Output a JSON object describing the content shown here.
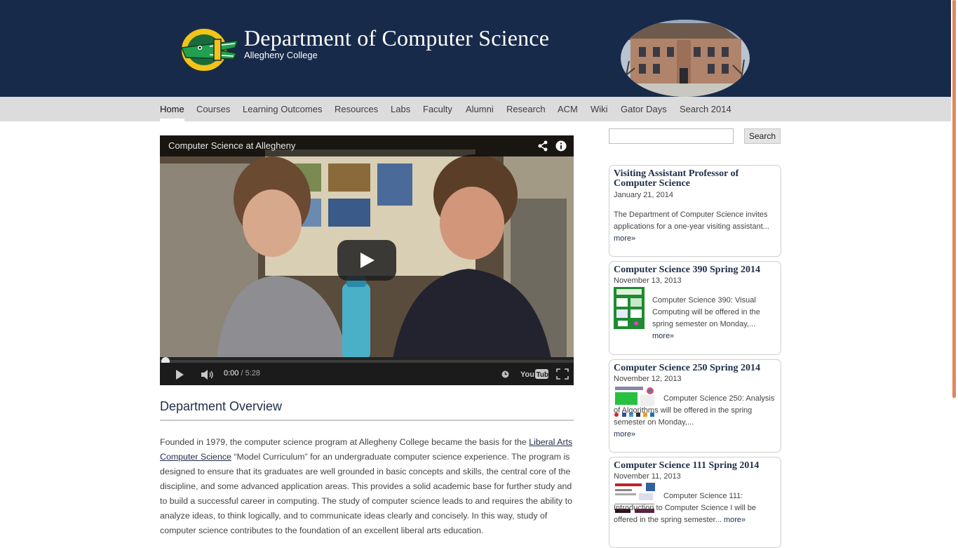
{
  "header": {
    "title": "Department of Computer Science",
    "subtitle": "Allegheny College",
    "logo_text_top": "ALLEGHENY",
    "logo_text_bottom": "GATORS"
  },
  "nav": {
    "items": [
      {
        "label": "Home",
        "active": true
      },
      {
        "label": "Courses"
      },
      {
        "label": "Learning Outcomes"
      },
      {
        "label": "Resources"
      },
      {
        "label": "Labs"
      },
      {
        "label": "Faculty"
      },
      {
        "label": "Alumni"
      },
      {
        "label": "Research"
      },
      {
        "label": "ACM"
      },
      {
        "label": "Wiki"
      },
      {
        "label": "Gator Days"
      },
      {
        "label": "Search 2014"
      }
    ]
  },
  "video": {
    "title": "Computer Science at Allegheny",
    "current_time": "0:00",
    "duration": " / 5:28",
    "progress": 0,
    "youtube_label": "YouTube"
  },
  "overview": {
    "heading": "Department Overview",
    "text_before_link": "Founded in 1979, the computer science program at Allegheny College became the basis for the ",
    "link_text": "Liberal Arts Computer Science",
    "text_after_link": " “Model Curriculum” for an undergraduate computer science experience.  The program is designed to ensure that its graduates are well grounded in basic concepts and skills, the central core of the discipline, and some advanced application areas.  This provides a solid academic base for further study and to build a successful career in computing.  The study of computer science leads to and requires the ability to analyze ideas, to think logically, and to communicate ideas clearly and concisely.  In this way, study of computer science contributes to the foundation of an excellent liberal arts education."
  },
  "sidebar": {
    "search": {
      "value": "",
      "placeholder": "",
      "button_label": "Search"
    },
    "posts": [
      {
        "title": "Visiting Assistant Professor of Computer Science",
        "date": "January 21, 2014",
        "excerpt": "The Department of Computer Science invites applications for a one-year visiting assistant...",
        "more": "more»"
      },
      {
        "title": "Computer Science 390 Spring 2014",
        "date": "November 13, 2013",
        "excerpt": "Computer Science 390: Visual Computing will be offered in the spring semester on Monday,...",
        "more": "more»"
      },
      {
        "title": "Computer Science 250 Spring 2014",
        "date": "November 12, 2013",
        "excerpt": "Computer Science 250: Analysis of Algorithms will be offered in the spring semester on Monday,...",
        "more": "more»"
      },
      {
        "title": "Computer Science 111 Spring 2014",
        "date": "November 11, 2013",
        "excerpt": "Computer Science 111: Introduction to Computer Science I will be offered in the spring semester...",
        "more": "more»"
      }
    ]
  },
  "colors": {
    "header_bg": "#182a4a",
    "nav_bg": "#dcdcdc",
    "link": "#1f2e4a",
    "scrollbar": "#e08860"
  }
}
